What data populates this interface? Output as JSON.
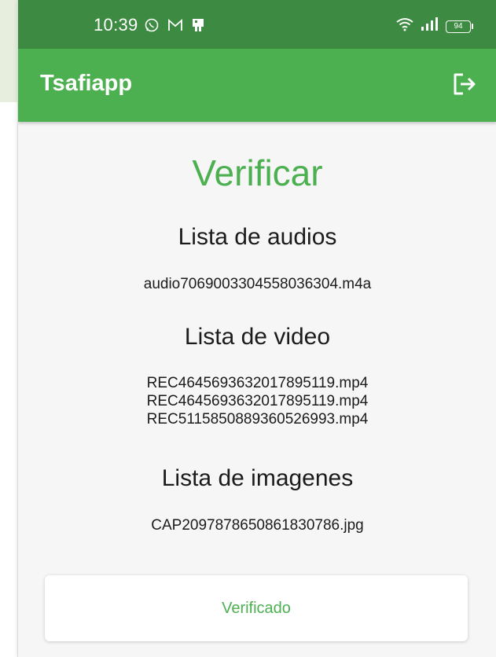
{
  "status_bar": {
    "time": "10:39",
    "battery": "94"
  },
  "app_bar": {
    "title": "Tsafiapp",
    "logout_icon": "logout-icon"
  },
  "main": {
    "title": "Verificar",
    "audio_section": {
      "heading": "Lista de audios",
      "files": [
        "audio7069003304558036304.m4a"
      ]
    },
    "video_section": {
      "heading": "Lista de video",
      "files": [
        "REC4645693632017895119.mp4",
        "REC4645693632017895119.mp4",
        "REC5115850889360526993.mp4"
      ]
    },
    "image_section": {
      "heading": "Lista de imagenes",
      "files": [
        "CAP2097878650861830786.jpg"
      ]
    },
    "verify_button": "Verificado"
  },
  "colors": {
    "status_bar": "#3d8b43",
    "app_bar": "#4caf50",
    "accent": "#4caf50",
    "background": "#f6f6f6"
  }
}
